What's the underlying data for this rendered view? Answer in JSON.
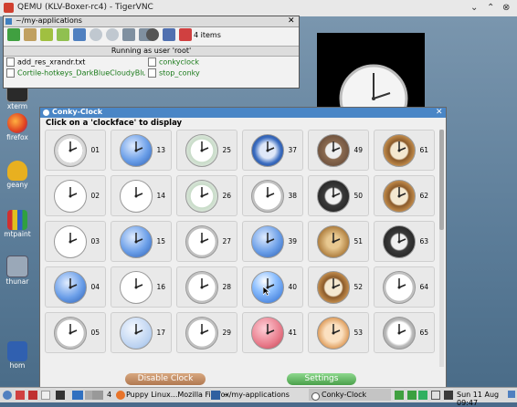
{
  "vnc": {
    "title": "QEMU (KLV-Boxer-rc4) - TigerVNC",
    "min": "⌄",
    "max": "⌃",
    "close": "⊗"
  },
  "desktop_icons": [
    {
      "label": "xterm",
      "color": "#2a2a2a"
    },
    {
      "label": "firefox",
      "color": "#e8742a"
    },
    {
      "label": "geany",
      "color": "#e0b020"
    },
    {
      "label": "mtpaint",
      "color": "#d04040"
    },
    {
      "label": "thunar",
      "color": "#8090a0"
    },
    {
      "label": "hom",
      "color": "#3060b0"
    }
  ],
  "file_manager": {
    "title": "~/my-applications",
    "items_count": "4 items",
    "status": "Running as user 'root'",
    "files": [
      {
        "name": "add_res_xrandr.txt"
      },
      {
        "name": "conkyclock"
      },
      {
        "name": "Cortile-hotkeys_DarkBlueCloudyBlue.s"
      },
      {
        "name": "stop_conky"
      }
    ]
  },
  "conky_window": {
    "title": "Conky-Clock",
    "header": "Click on a 'clockface' to display",
    "clocks": [
      {
        "num": "01",
        "style": "roman-white"
      },
      {
        "num": "13",
        "style": "blue"
      },
      {
        "num": "25",
        "style": "white-green"
      },
      {
        "num": "37",
        "style": "blue-dark"
      },
      {
        "num": "49",
        "style": "brown-roman"
      },
      {
        "num": "61",
        "style": "bronze"
      },
      {
        "num": "02",
        "style": "white-plain"
      },
      {
        "num": "14",
        "style": "white-plain"
      },
      {
        "num": "26",
        "style": "white-green"
      },
      {
        "num": "38",
        "style": "white-roman"
      },
      {
        "num": "50",
        "style": "dark-roman"
      },
      {
        "num": "62",
        "style": "bronze"
      },
      {
        "num": "03",
        "style": "white-plain"
      },
      {
        "num": "15",
        "style": "blue"
      },
      {
        "num": "27",
        "style": "white-roman"
      },
      {
        "num": "39",
        "style": "blue"
      },
      {
        "num": "51",
        "style": "wood"
      },
      {
        "num": "63",
        "style": "dark-roman"
      },
      {
        "num": "04",
        "style": "blue"
      },
      {
        "num": "16",
        "style": "white-plain"
      },
      {
        "num": "28",
        "style": "white-roman"
      },
      {
        "num": "40",
        "style": "blue-ball"
      },
      {
        "num": "52",
        "style": "bronze"
      },
      {
        "num": "64",
        "style": "white-roman"
      },
      {
        "num": "05",
        "style": "white-roman"
      },
      {
        "num": "17",
        "style": "blue-light"
      },
      {
        "num": "29",
        "style": "white-roman"
      },
      {
        "num": "41",
        "style": "pink"
      },
      {
        "num": "53",
        "style": "orange"
      },
      {
        "num": "65",
        "style": "silver"
      }
    ],
    "disable_button": "Disable Clock",
    "settings_button": "Settings"
  },
  "taskbar": {
    "desktop_num": "4",
    "tasks": [
      "Puppy Linux...Mozilla Firefox",
      "~/my-applications",
      "Conky-Clock"
    ],
    "clock": "Sun 11 Aug 09:47"
  },
  "colors": {
    "window_title": "#4a86c6",
    "disable_btn": "#c8926a",
    "settings_btn": "#6cc06c"
  }
}
